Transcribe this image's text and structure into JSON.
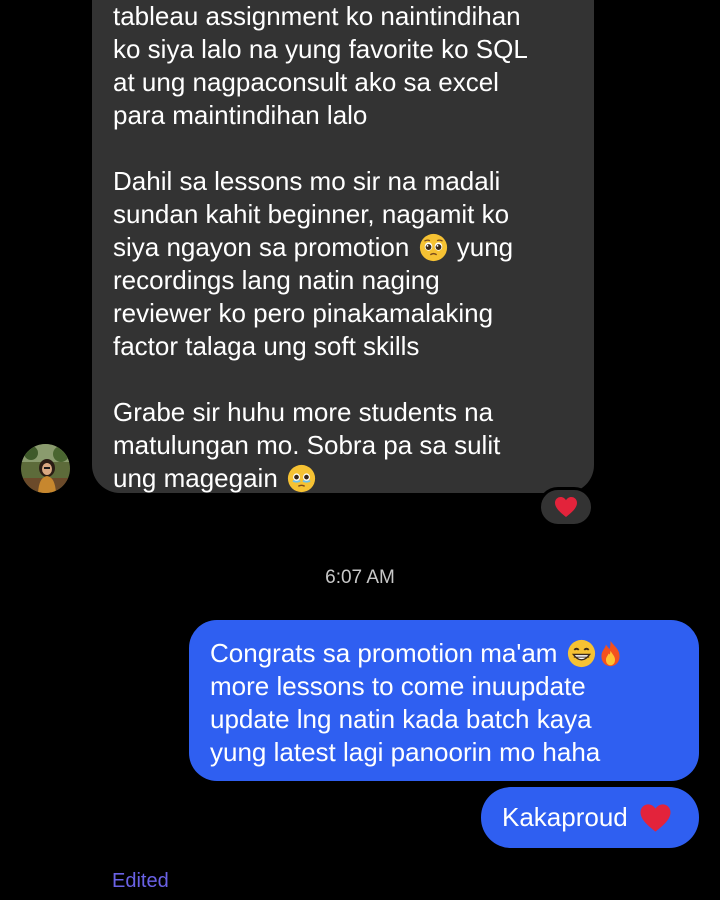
{
  "incoming_message": {
    "lines_p1": [
      "tableau assignment ko naintindihan",
      "ko siya lalo na yung favorite ko SQL",
      "at ung nagpaconsult ako sa excel",
      "para maintindihan lalo"
    ],
    "p2_line1": "Dahil sa lessons mo sir na madali",
    "p2_line2": "sundan kahit beginner, nagamit ko",
    "p2_line3_before": "siya ngayon sa promotion",
    "p2_line3_emoji": "pleading-face-emoji",
    "p2_line3_after": "yung",
    "p2_line4": "recordings lang natin naging",
    "p2_line5": "reviewer ko pero pinakamalaking",
    "p2_line6": "factor talaga ung soft skills",
    "p3_line1": "Grabe sir huhu more students na",
    "p3_line2": "matulungan mo. Sobra pa sa sulit",
    "p3_line3_before": "ung magegain",
    "p3_line3_emoji": "face-holding-back-tears-emoji",
    "reaction": "red-heart-emoji"
  },
  "timestamp": "6:07 AM",
  "outgoing_message_1": {
    "line1": "Congrats sa promotion ma'am",
    "line1_emojis": [
      "grinning-face-emoji",
      "fire-emoji"
    ],
    "line2": "more lessons to come inuupdate",
    "line3": "update lng natin kada batch kaya",
    "line4": "yung latest lagi panoorin mo haha"
  },
  "outgoing_message_2": {
    "text": "Kakaproud",
    "emoji": "red-heart-emoji"
  },
  "edited_label": "Edited",
  "colors": {
    "background": "#000000",
    "incoming_bubble": "#333333",
    "outgoing_bubble": "#2f5ff1",
    "edited_text": "#6a62e6",
    "timestamp_text": "#c8c8c8"
  }
}
